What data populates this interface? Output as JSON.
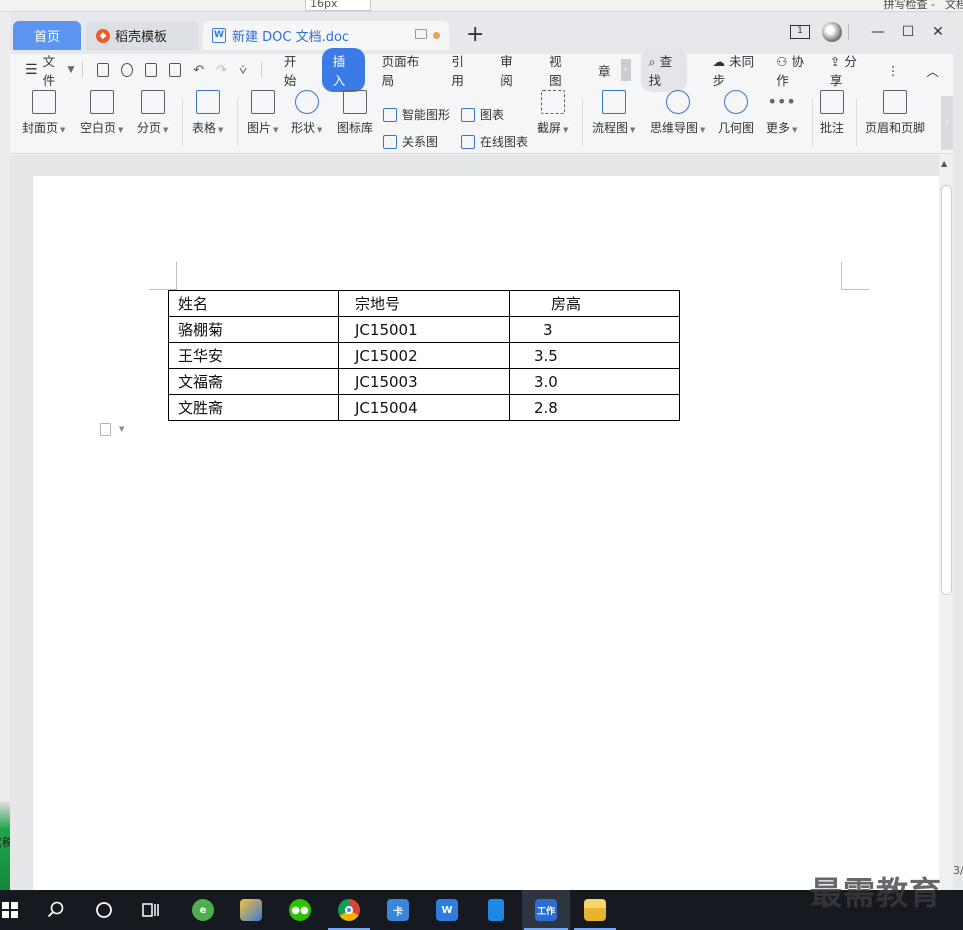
{
  "background_app": {
    "font_size_value": "16px",
    "menu_right_1": "拼写检查 -",
    "menu_right_2": "文档"
  },
  "desktop_left_label": "(稿",
  "tabs": {
    "home": "首页",
    "template": "稻壳模板",
    "document": "新建 DOC 文档.doc",
    "add": "+"
  },
  "window_controls": {
    "page_indicator": "1",
    "minimize": "—",
    "maximize": "☐",
    "close": "✕"
  },
  "menu": {
    "hamburger": "☰",
    "file": "文件",
    "tabs": [
      "开始",
      "插入",
      "页面布局",
      "引用",
      "审阅",
      "视图",
      "章"
    ],
    "active_tab": "插入",
    "search": "查找",
    "sync": "未同步",
    "collab": "协作",
    "share": "分享"
  },
  "ribbon": {
    "cover": "封面页",
    "blank": "空白页",
    "page_break": "分页",
    "table": "表格",
    "picture": "图片",
    "shape": "形状",
    "icon_lib": "图标库",
    "smart_shape": "智能图形",
    "chart": "图表",
    "relation": "关系图",
    "online_chart": "在线图表",
    "screenshot": "截屏",
    "flowchart": "流程图",
    "mindmap": "思维导图",
    "geometry": "几何图",
    "more": "更多",
    "comment": "批注",
    "header_footer": "页眉和页脚"
  },
  "document_table": {
    "headers": [
      "姓名",
      "宗地号",
      "房高"
    ],
    "rows": [
      [
        "骆棚菊",
        "JC15001",
        "3"
      ],
      [
        "王华安",
        "JC15002",
        "3.5"
      ],
      [
        "文福斋",
        "JC15003",
        "3.0"
      ],
      [
        "文胜斋",
        "JC15004",
        "2.8"
      ]
    ]
  },
  "right_edge_label": "3/",
  "taskbar_icons": [
    "start-icon",
    "search-icon",
    "cortana-icon",
    "task-view-icon",
    "ie-icon",
    "app-folder-icon",
    "wechat-icon",
    "chrome-icon",
    "card-app-icon",
    "wps-icon",
    "phone-app-icon",
    "work-app-icon",
    "file-explorer-icon"
  ],
  "taskbar_text": {
    "wps": "W",
    "work": "工作",
    "card": "卡"
  },
  "watermark": "最需教育",
  "colors": {
    "accent": "#3b7be8",
    "home_tab": "#5b95f0",
    "taskbar": "#16191f"
  }
}
